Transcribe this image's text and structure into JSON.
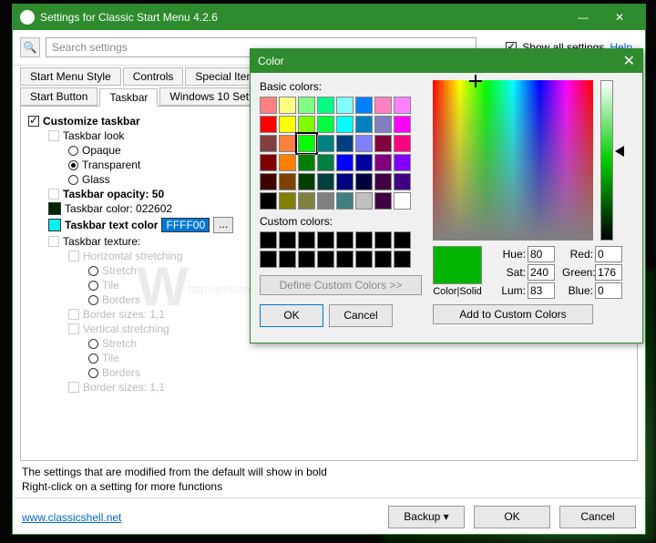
{
  "window": {
    "title": "Settings for Classic Start Menu 4.2.6",
    "search_placeholder": "Search settings",
    "show_all_label": "Show all settings",
    "help_label": "Help"
  },
  "tabs": {
    "row1": [
      "Start Menu Style",
      "Controls",
      "Special Items"
    ],
    "row2": [
      "Start Button",
      "Taskbar",
      "Windows 10 Settings"
    ],
    "active": "Taskbar"
  },
  "tree": {
    "customize": "Customize taskbar",
    "look": "Taskbar look",
    "opaque": "Opaque",
    "transparent": "Transparent",
    "glass": "Glass",
    "opacity": "Taskbar opacity: 50",
    "color": "Taskbar color: 022602",
    "text_color_label": "Taskbar text color",
    "text_color_value": "FFFF00",
    "dots": "...",
    "texture": "Taskbar texture:",
    "hstretch": "Horizontal stretching",
    "stretch": "Stretch",
    "tile": "Tile",
    "borders": "Borders",
    "bsizes": "Border sizes: 1,1",
    "vstretch": "Vertical stretching"
  },
  "footer": {
    "info1": "The settings that are modified from the default will show in bold",
    "info2": "Right-click on a setting for more functions",
    "link": "www.classicshell.net",
    "backup": "Backup",
    "ok": "OK",
    "cancel": "Cancel"
  },
  "watermark": "http://winaero.com",
  "color_dlg": {
    "title": "Color",
    "basic": "Basic colors:",
    "custom": "Custom colors:",
    "define": "Define Custom Colors >>",
    "ok": "OK",
    "cancel": "Cancel",
    "solid": "Color|Solid",
    "hue_l": "Hue:",
    "hue": "80",
    "sat_l": "Sat:",
    "sat": "240",
    "lum_l": "Lum:",
    "lum": "83",
    "red_l": "Red:",
    "red": "0",
    "green_l": "Green:",
    "green": "176",
    "blue_l": "Blue:",
    "blue": "0",
    "add": "Add to Custom Colors",
    "basic_colors": [
      "#ff8080",
      "#ffff80",
      "#80ff80",
      "#00ff80",
      "#80ffff",
      "#0080ff",
      "#ff80c0",
      "#ff80ff",
      "#ff0000",
      "#ffff00",
      "#80ff00",
      "#00ff40",
      "#00ffff",
      "#0080c0",
      "#8080c0",
      "#ff00ff",
      "#804040",
      "#ff8040",
      "#00ff00",
      "#008080",
      "#004080",
      "#8080ff",
      "#800040",
      "#ff0080",
      "#800000",
      "#ff8000",
      "#008000",
      "#008040",
      "#0000ff",
      "#0000a0",
      "#800080",
      "#8000ff",
      "#400000",
      "#804000",
      "#004000",
      "#004040",
      "#000080",
      "#000040",
      "#400040",
      "#400080",
      "#000000",
      "#808000",
      "#808040",
      "#808080",
      "#408080",
      "#c0c0c0",
      "#400040",
      "#ffffff"
    ],
    "selected_index": 18
  }
}
